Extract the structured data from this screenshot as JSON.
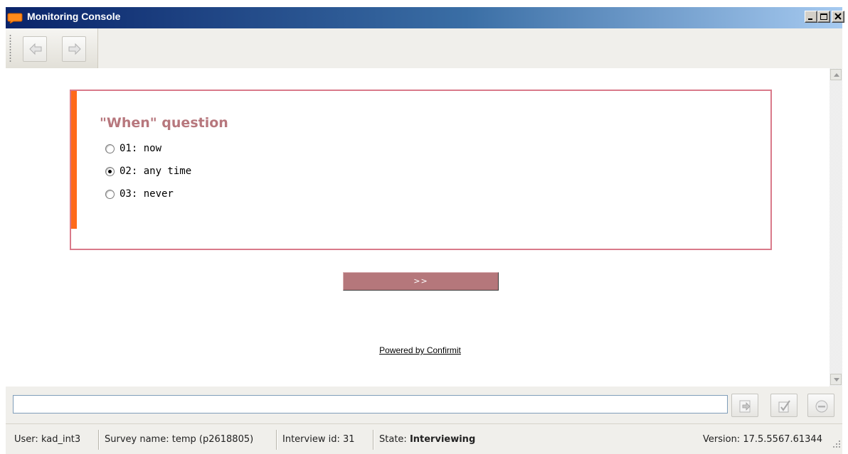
{
  "window": {
    "title": "Monitoring Console",
    "controls": [
      "minimize",
      "maximize",
      "close"
    ]
  },
  "toolbar": {
    "buttons": [
      {
        "name": "back",
        "icon": "arrow-left-icon"
      },
      {
        "name": "forward",
        "icon": "arrow-right-icon"
      }
    ]
  },
  "question": {
    "title": "\"When\" question",
    "options": [
      {
        "label": "01: now",
        "checked": false
      },
      {
        "label": "02: any time",
        "checked": true
      },
      {
        "label": "03: never",
        "checked": false
      }
    ],
    "next_label": ">>"
  },
  "footer": {
    "powered_by": "Powered by Confirmit"
  },
  "command": {
    "input_value": "",
    "buttons": [
      "send-icon",
      "check-icon",
      "stop-icon"
    ]
  },
  "status": {
    "user_label": "User:",
    "user_value": "kad_int3",
    "survey_label": "Survey name:",
    "survey_value": "temp (p2618805)",
    "interview_label": "Interview id:",
    "interview_value": "31",
    "state_label": "State:",
    "state_value": "Interviewing",
    "version_label": "Version:",
    "version_value": "17.5.5567.61344"
  },
  "colors": {
    "question_border": "#d97a8a",
    "question_accent": "#ff6a1a",
    "question_title": "#b7777d",
    "next_button": "#b5777b",
    "titlebar_start": "#0a246a",
    "titlebar_end": "#a6caf0"
  }
}
